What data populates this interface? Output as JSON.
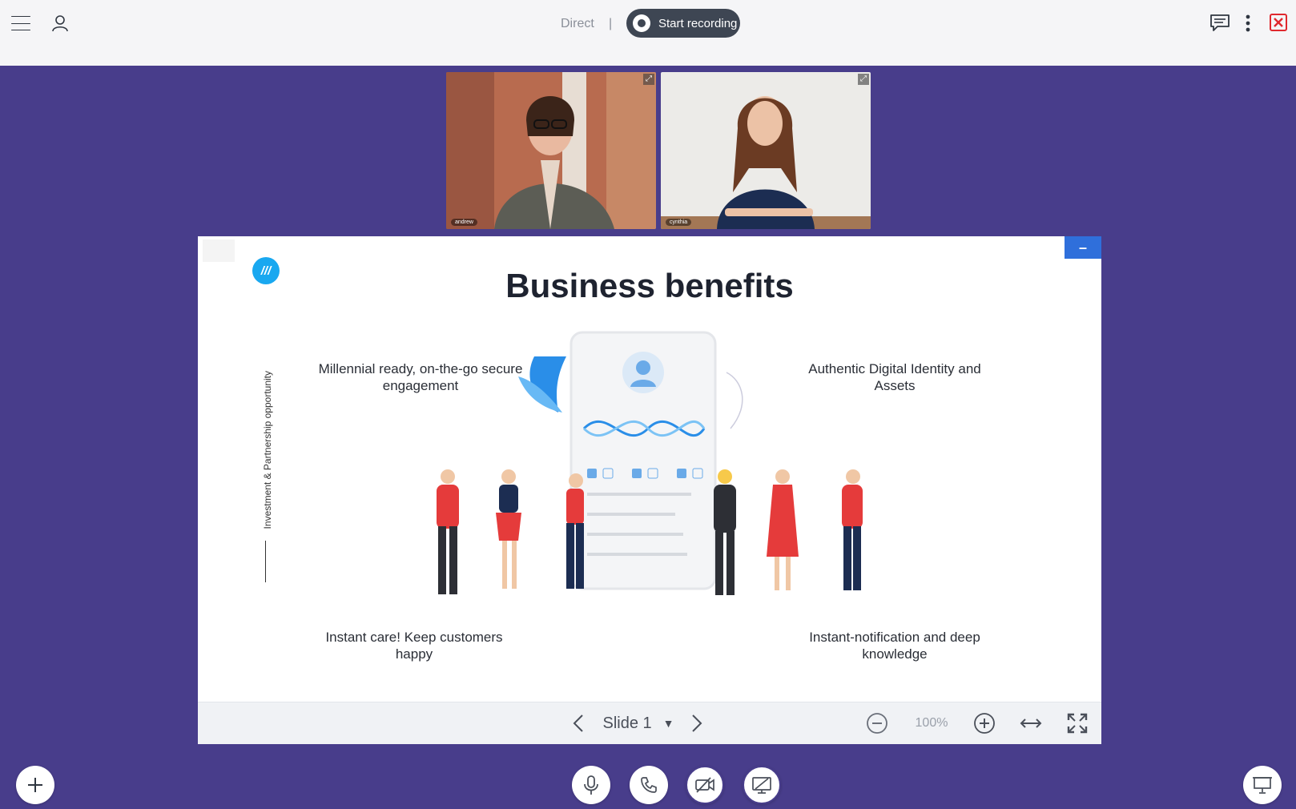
{
  "topbar": {
    "status": "Direct",
    "separator": "|",
    "record_label": "Start recording"
  },
  "participants": [
    {
      "name": "andrew"
    },
    {
      "name": "cynthia"
    }
  ],
  "slide": {
    "title": "Business benefits",
    "logo_text": "///",
    "side_text": "Investment & Partnership opportunity",
    "features": {
      "top_left": "Millennial ready, on-the-go secure engagement",
      "top_right": "Authentic Digital Identity and Assets",
      "bottom_left": "Instant care! Keep customers happy",
      "bottom_right": "Instant-notification and deep knowledge"
    }
  },
  "slide_toolbar": {
    "slide_label": "Slide 1",
    "zoom": "100%"
  },
  "colors": {
    "stage_bg": "#483d8b",
    "accent_blue": "#19a8f0",
    "close_red": "#e0282e",
    "minimize_blue": "#2f6fdb"
  }
}
